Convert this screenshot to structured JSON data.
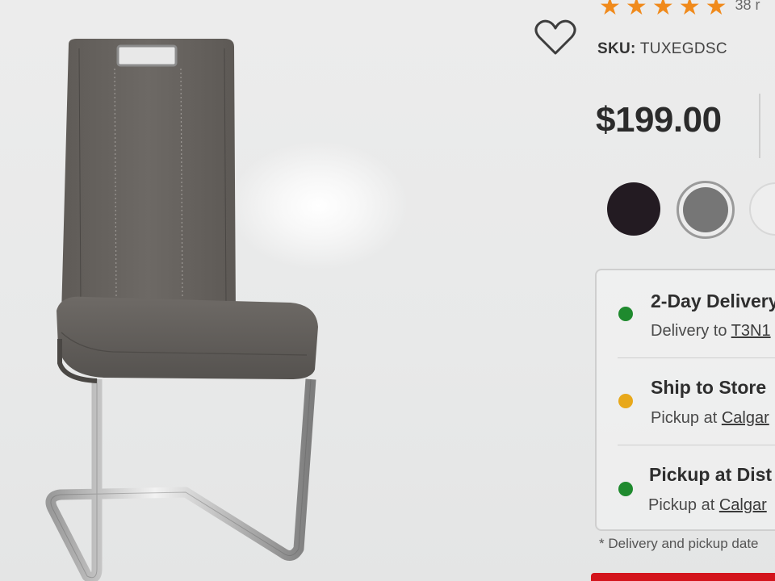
{
  "rating": {
    "stars": 5,
    "star_glyph": "★",
    "review_count": "38 r"
  },
  "icons": {
    "wishlist": "heart-outline-icon",
    "rating": "star-icon",
    "status": "status-dot-icon"
  },
  "product": {
    "sku_label": "SKU:",
    "sku_value": "TUXEGDSC",
    "price": "$199.00"
  },
  "swatches": [
    {
      "name": "black",
      "color": "#231b22"
    },
    {
      "name": "grey",
      "color": "#767676",
      "selected": true
    },
    {
      "name": "light",
      "color": "#eeeeee"
    }
  ],
  "fulfillment": {
    "options": [
      {
        "title": "2-Day Delivery",
        "sub_prefix": "Delivery to ",
        "sub_link": "T3N1",
        "status_color": "#1f8a2e"
      },
      {
        "title": "Ship to Store",
        "sub_prefix": "Pickup at ",
        "sub_link": "Calgar",
        "status_color": "#e8a81a"
      },
      {
        "title": "Pickup at Dist",
        "sub_prefix": "Pickup at ",
        "sub_link": "Calgar",
        "status_color": "#1f8a2e"
      }
    ]
  },
  "footnote": "* Delivery and pickup date",
  "colors": {
    "accent_red": "#d3141c",
    "star_orange": "#f08a1c"
  }
}
